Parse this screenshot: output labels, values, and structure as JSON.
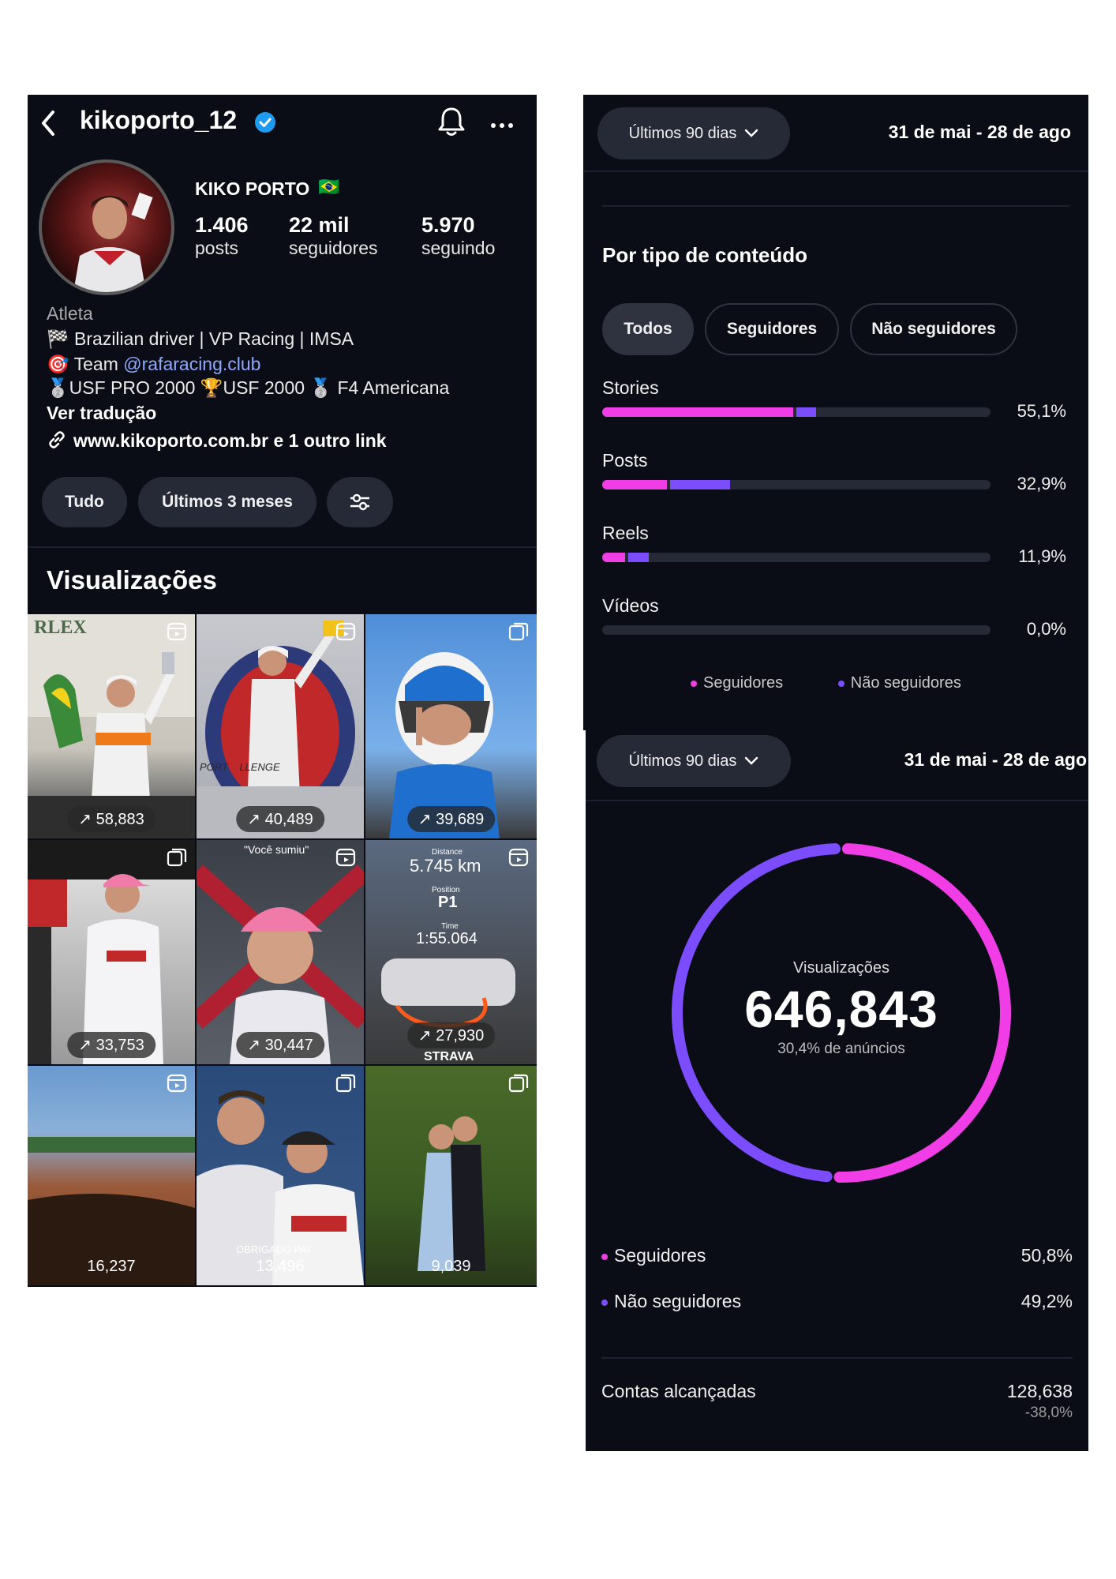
{
  "colors": {
    "accent_pink": "#f03de6",
    "accent_purple": "#7c4dff",
    "panel_bg": "#0b0d16",
    "verified_blue": "#1d9bf0"
  },
  "profile": {
    "username": "kikoporto_12",
    "display_name": "KIKO PORTO",
    "flag": "🇧🇷",
    "stats": [
      {
        "value": "1.406",
        "label": "posts"
      },
      {
        "value": "22 mil",
        "label": "seguidores"
      },
      {
        "value": "5.970",
        "label": "seguindo"
      }
    ],
    "category": "Atleta",
    "bio": {
      "line1": "Brazilian driver | VP Racing | IMSA",
      "line2_prefix": "Team ",
      "line2_link": "@rafaracing.club",
      "line3a": "USF PRO 2000",
      "line3b": "USF 2000",
      "line3c": "F4 Americana",
      "translate": "Ver tradução",
      "link": "www.kikoporto.com.br e 1 outro link"
    },
    "filters": {
      "all": "Tudo",
      "period": "Últimos 3 meses"
    },
    "section_title": "Visualizações",
    "grid": [
      {
        "views": "58,883",
        "type": "reel",
        "overlay": "RLEX"
      },
      {
        "views": "40,489",
        "type": "reel",
        "overlay": "PORT    LLENGE"
      },
      {
        "views": "39,689",
        "type": "carousel",
        "overlay": ""
      },
      {
        "views": "33,753",
        "type": "carousel",
        "overlay": ""
      },
      {
        "views": "30,447",
        "type": "reel",
        "overlay": "\"Você sumiu\""
      },
      {
        "views": "27,930",
        "type": "reel",
        "overlay": "STRAVA",
        "distance_label": "Distance",
        "distance": "5.745 km",
        "position_label": "Position",
        "position": "P1",
        "time_label": "Time",
        "time": "1:55.064"
      },
      {
        "views": "16,237",
        "type": "reel",
        "overlay": ""
      },
      {
        "views": "13,496",
        "type": "carousel",
        "overlay": "OBRIGADO PAI"
      },
      {
        "views": "9,039",
        "type": "carousel",
        "overlay": ""
      }
    ]
  },
  "content_type": {
    "range_selector": "Últimos 90 dias",
    "date_range": "31 de mai - 28 de ago",
    "title": "Por tipo de conteúdo",
    "tabs": [
      "Todos",
      "Seguidores",
      "Não seguidores"
    ],
    "rows": [
      {
        "label": "Stories",
        "pct_text": "55,1%",
        "followers": 49.5,
        "non_followers": 5.6
      },
      {
        "label": "Posts",
        "pct_text": "32,9%",
        "followers": 17.0,
        "non_followers": 15.9
      },
      {
        "label": "Reels",
        "pct_text": "11,9%",
        "followers": 6.2,
        "non_followers": 5.7
      },
      {
        "label": "Vídeos",
        "pct_text": "0,0%",
        "followers": 0,
        "non_followers": 0
      }
    ],
    "legend": [
      "Seguidores",
      "Não seguidores"
    ]
  },
  "views_summary": {
    "range_selector": "Últimos 90 dias",
    "date_range": "31 de mai - 28 de ago",
    "donut_label": "Visualizações",
    "total": "646,843",
    "ads_text": "30,4% de anúncios",
    "followers_pct": 50.8,
    "breakdown": [
      {
        "label": "Seguidores",
        "value": "50,8%"
      },
      {
        "label": "Não seguidores",
        "value": "49,2%"
      }
    ],
    "reach_label": "Contas alcançadas",
    "reach_value": "128,638",
    "reach_change": "-38,0%"
  }
}
